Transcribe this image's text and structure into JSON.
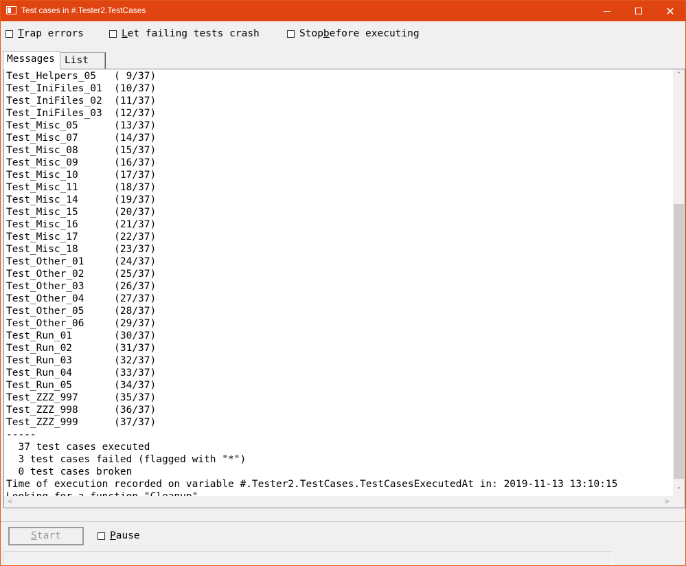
{
  "window": {
    "title": "Test cases in #.Tester2.TestCases",
    "minimize_icon": "minimize-icon",
    "maximize_icon": "maximize-icon",
    "close_icon": "close-icon",
    "close_glyph": "✕"
  },
  "options": {
    "trap_errors": {
      "u": "T",
      "rest": "rap errors",
      "checked": false
    },
    "let_failing": {
      "u": "L",
      "rest": "et failing tests crash",
      "checked": false
    },
    "stop_before": {
      "pre": "Stop ",
      "u": "b",
      "rest": "efore executing",
      "checked": false
    }
  },
  "tabs": [
    {
      "label": "Messages",
      "active": true
    },
    {
      "label": "List",
      "active": false
    }
  ],
  "messages": [
    "Test_Helpers_05   ( 9/37)",
    "Test_IniFiles_01  (10/37)",
    "Test_IniFiles_02  (11/37)",
    "Test_IniFiles_03  (12/37)",
    "Test_Misc_05      (13/37)",
    "Test_Misc_07      (14/37)",
    "Test_Misc_08      (15/37)",
    "Test_Misc_09      (16/37)",
    "Test_Misc_10      (17/37)",
    "Test_Misc_11      (18/37)",
    "Test_Misc_14      (19/37)",
    "Test_Misc_15      (20/37)",
    "Test_Misc_16      (21/37)",
    "Test_Misc_17      (22/37)",
    "Test_Misc_18      (23/37)",
    "Test_Other_01     (24/37)",
    "Test_Other_02     (25/37)",
    "Test_Other_03     (26/37)",
    "Test_Other_04     (27/37)",
    "Test_Other_05     (28/37)",
    "Test_Other_06     (29/37)",
    "Test_Run_01       (30/37)",
    "Test_Run_02       (31/37)",
    "Test_Run_03       (32/37)",
    "Test_Run_04       (33/37)",
    "Test_Run_05       (34/37)",
    "Test_ZZZ_997      (35/37)",
    "Test_ZZZ_998      (36/37)",
    "Test_ZZZ_999      (37/37)",
    "-----",
    "  37 test cases executed",
    "  3 test cases failed (flagged with \"*\")",
    "  0 test cases broken",
    "Time of execution recorded on variable #.Tester2.TestCases.TestCasesExecutedAt in: 2019-11-13 13:10:15",
    "Looking for a function \"Cleanup\"..."
  ],
  "scroll": {
    "up": "˄",
    "down": "˅",
    "left": "<",
    "right": ">"
  },
  "controls": {
    "start": {
      "u": "S",
      "rest": "tart",
      "enabled": false
    },
    "pause": {
      "u": "P",
      "rest": "ause",
      "checked": false
    }
  },
  "status_text": ""
}
